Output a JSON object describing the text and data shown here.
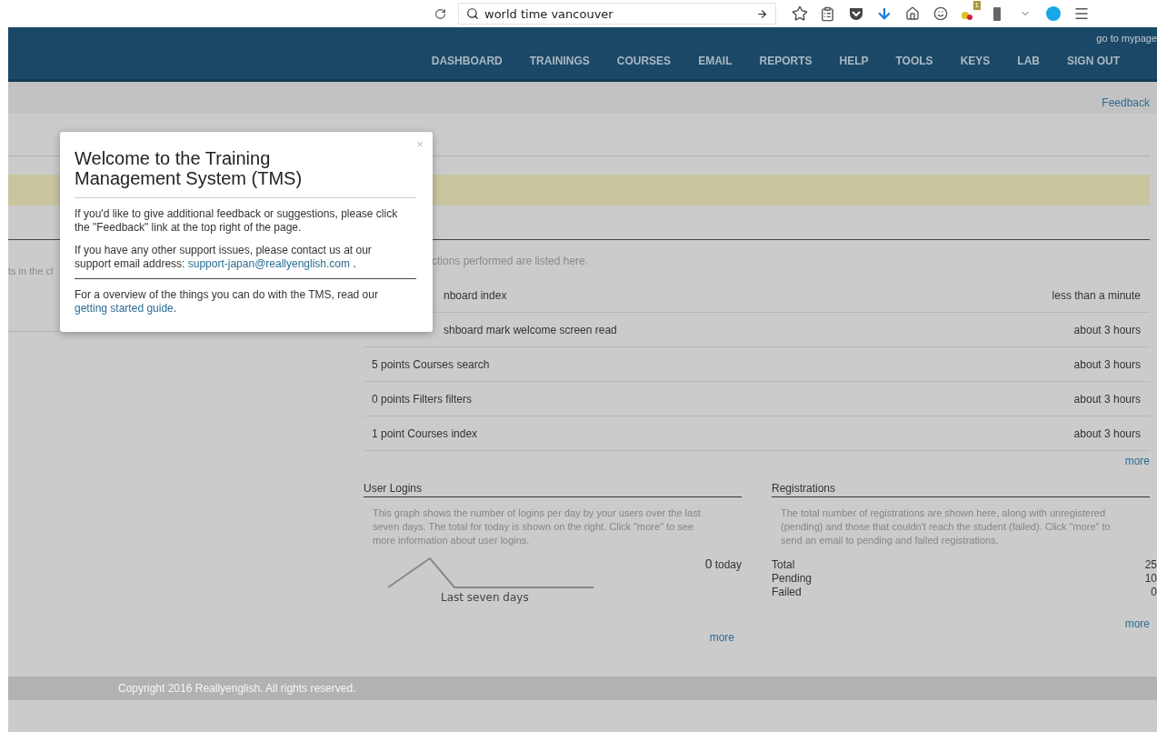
{
  "browser": {
    "url": "world time vancouver",
    "extension_badge": "1"
  },
  "header": {
    "mypage_link": "go to mypage",
    "nav": [
      "DASHBOARD",
      "TRAININGS",
      "COURSES",
      "EMAIL",
      "REPORTS",
      "HELP",
      "TOOLS",
      "KEYS",
      "LAB",
      "SIGN OUT"
    ]
  },
  "subbar": {
    "feedback_link": "Feedback"
  },
  "left_panel": {
    "fragment": "ts in the cl"
  },
  "activity": {
    "intro": "ctions performed are listed here.",
    "rows": [
      {
        "action": "nboard index",
        "time": "less than a minute"
      },
      {
        "action": "shboard mark welcome screen read",
        "time": "about 3 hours"
      },
      {
        "action": "5 points Courses search",
        "time": "about 3 hours"
      },
      {
        "action": "0 points Filters filters",
        "time": "about 3 hours"
      },
      {
        "action": "1 point Courses index",
        "time": "about 3 hours"
      }
    ],
    "more": "more"
  },
  "user_logins": {
    "title": "User Logins",
    "description": "This graph shows the number of logins per day by your users over the last seven days. The total for today is shown on the right. Click \"more\" to see more information about user logins.",
    "today_count": "0",
    "today_label": "today",
    "graph_label": "Last seven days",
    "more": "more"
  },
  "registrations": {
    "title": "Registrations",
    "description": "The total number of registrations are shown here, along with unregistered (pending) and those that couldn't reach the student (failed). Click \"more\" to send an email to pending and failed registrations.",
    "stats": [
      {
        "label": "Total",
        "value": "25"
      },
      {
        "label": "Pending",
        "value": "10"
      },
      {
        "label": "Failed",
        "value": "0"
      }
    ],
    "more": "more"
  },
  "footer": {
    "copyright": "Copyright 2016 Reallyenglish. All rights reserved."
  },
  "modal": {
    "close": "×",
    "title": "Welcome to the Training Management System (TMS)",
    "paragraphs": [
      "If you'd like to give additional feedback or suggestions, please click the \"Feedback\" link at the top right of the page."
    ],
    "support_text": "If you have any other support issues, please contact us at our support email address:",
    "support_email": "support-japan@reallyenglish.com",
    "support_end": ".",
    "guide_text": "For a overview of the things you can do with the TMS, read our",
    "guide_link": "getting started guide",
    "guide_end": "."
  }
}
